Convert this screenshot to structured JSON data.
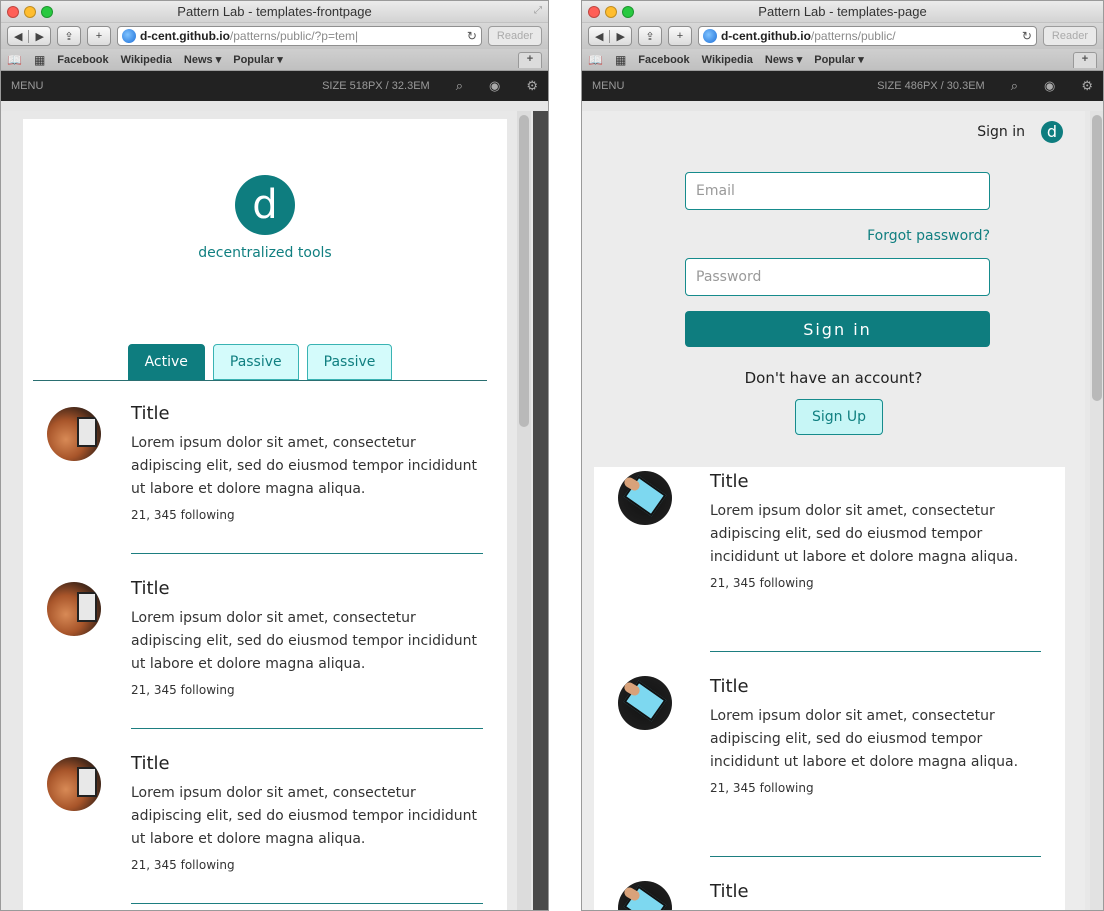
{
  "colors": {
    "brand_teal": "#0e7d7f",
    "tab_passive_bg": "#d4fbfb",
    "header_dark": "#222222"
  },
  "window1": {
    "title": "Pattern Lab - templates-frontpage",
    "url_host": "d-cent.github.io",
    "url_path": "/patterns/public/?p=tem|",
    "reader_label": "Reader",
    "bookmarks": [
      "Facebook",
      "Wikipedia",
      "News ▾",
      "Popular ▾"
    ],
    "pl_menu": "MENU",
    "pl_size": "SIZE 518PX / 32.3EM",
    "logo_letter": "d",
    "logo_text": "decentralized tools",
    "tabs": [
      "Active",
      "Passive",
      "Passive"
    ],
    "feed": [
      {
        "title": "Title",
        "text": "Lorem ipsum dolor sit amet, consectetur adipiscing elit, sed do eiusmod tempor incididunt ut labore et dolore magna aliqua.",
        "meta": "21, 345 following"
      },
      {
        "title": "Title",
        "text": "Lorem ipsum dolor sit amet, consectetur adipiscing elit, sed do eiusmod tempor incididunt ut labore et dolore magna aliqua.",
        "meta": "21, 345 following"
      },
      {
        "title": "Title",
        "text": "Lorem ipsum dolor sit amet, consectetur adipiscing elit, sed do eiusmod tempor incididunt ut labore et dolore magna aliqua.",
        "meta": "21, 345 following"
      }
    ]
  },
  "window2": {
    "title": "Pattern Lab - templates-page",
    "url_host": "d-cent.github.io",
    "url_path": "/patterns/public/",
    "reader_label": "Reader",
    "bookmarks": [
      "Facebook",
      "Wikipedia",
      "News ▾",
      "Popular ▾"
    ],
    "pl_menu": "MENU",
    "pl_size": "SIZE 486PX / 30.3EM",
    "sign_in_link": "Sign in",
    "logo_letter": "d",
    "email_placeholder": "Email",
    "forgot_password": "Forgot password?",
    "password_placeholder": "Password",
    "sign_in_button": "Sign in",
    "no_account_text": "Don't have an account?",
    "sign_up_button": "Sign Up",
    "feed": [
      {
        "title": "Title",
        "text": "Lorem ipsum dolor sit amet, consectetur adipiscing elit, sed do eiusmod tempor incididunt ut labore et dolore magna aliqua.",
        "meta": "21, 345 following"
      },
      {
        "title": "Title",
        "text": "Lorem ipsum dolor sit amet, consectetur adipiscing elit, sed do eiusmod tempor incididunt ut labore et dolore magna aliqua.",
        "meta": "21, 345 following"
      },
      {
        "title": "Title"
      }
    ]
  }
}
